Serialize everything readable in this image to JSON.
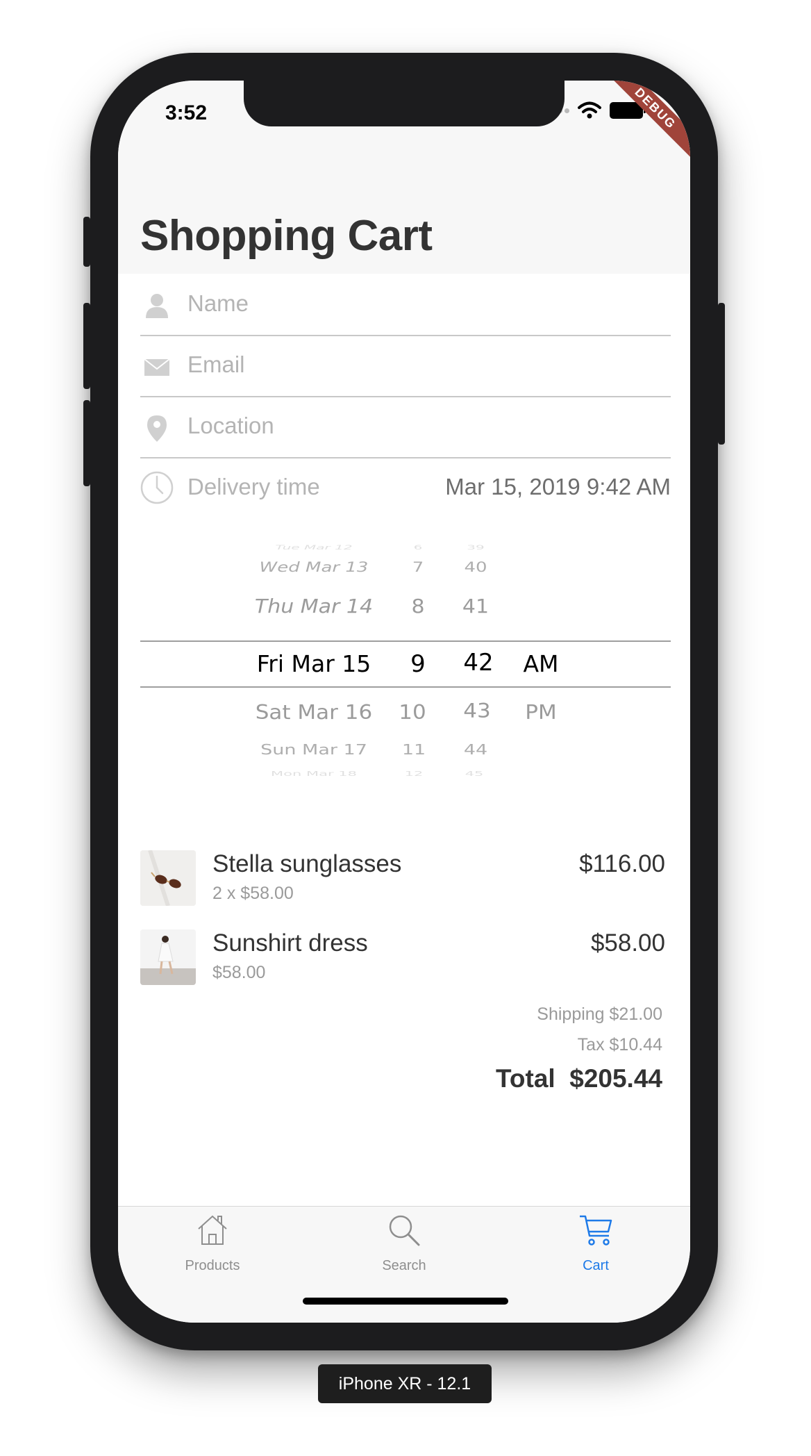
{
  "status_bar": {
    "time": "3:52"
  },
  "debug_banner": "DEBUG",
  "page": {
    "title": "Shopping Cart"
  },
  "form": {
    "name_placeholder": "Name",
    "email_placeholder": "Email",
    "location_placeholder": "Location",
    "delivery_label": "Delivery time",
    "delivery_value": "Mar 15, 2019 9:42 AM"
  },
  "picker": {
    "dates": [
      "Tue Mar 12",
      "Wed Mar 13",
      "Thu Mar 14",
      "Fri Mar 15",
      "Sat Mar 16",
      "Sun Mar 17",
      "Mon Mar 18"
    ],
    "hours": [
      "6",
      "7",
      "8",
      "9",
      "10",
      "11",
      "12"
    ],
    "minutes": [
      "39",
      "40",
      "41",
      "42",
      "43",
      "44",
      "45"
    ],
    "ampm": [
      "AM",
      "PM"
    ]
  },
  "cart": {
    "items": [
      {
        "name": "Stella sunglasses",
        "detail": "2 x $58.00",
        "price": "$116.00"
      },
      {
        "name": "Sunshirt dress",
        "detail": "$58.00",
        "price": "$58.00"
      }
    ],
    "shipping": "Shipping $21.00",
    "tax": "Tax $10.44",
    "total": "Total  $205.44"
  },
  "tabs": [
    {
      "label": "Products",
      "icon": "home-icon",
      "active": false
    },
    {
      "label": "Search",
      "icon": "search-icon",
      "active": false
    },
    {
      "label": "Cart",
      "icon": "cart-icon",
      "active": true
    }
  ],
  "device_label": "iPhone XR - 12.1",
  "colors": {
    "accent": "#1e7ae8",
    "debug": "#a0443a",
    "frame": "#1c1c1e"
  }
}
